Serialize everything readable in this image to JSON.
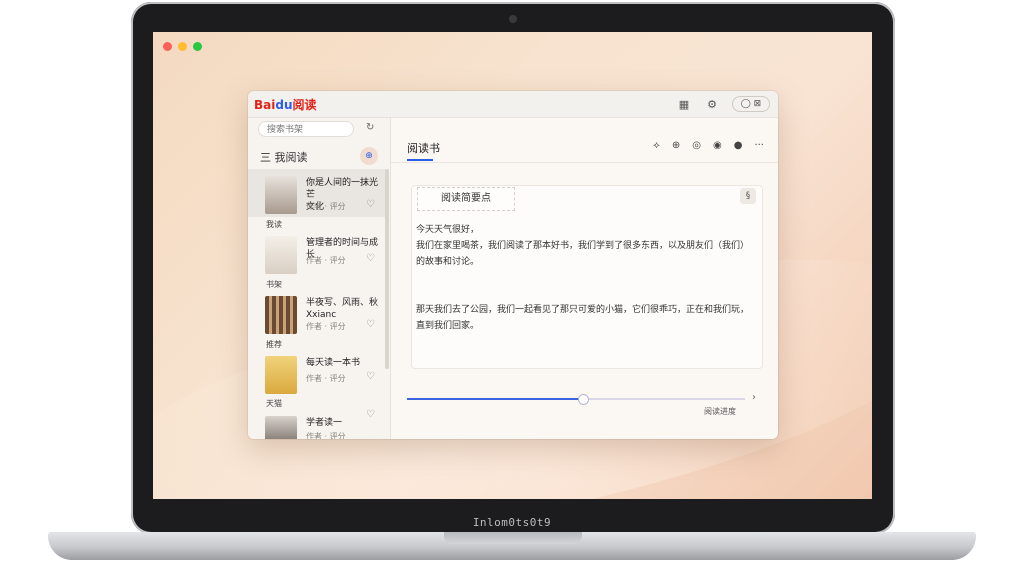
{
  "bezel_label": "Inlom0ts0t9",
  "colors": {
    "accent": "#2a5ee8",
    "brand_red": "#e2231a",
    "traffic_close": "#fe5f57",
    "traffic_min": "#febc2e",
    "traffic_max": "#28c840"
  },
  "app": {
    "brand_main": "Bai",
    "brand_accent": "du",
    "brand_suffix": "阅读",
    "titlebar_icons": [
      "grid-icon",
      "settings-icon"
    ],
    "titlebar_pill": "◯ ⊠"
  },
  "sidebar": {
    "search_placeholder": "搜索书架",
    "refresh_icon": "↻",
    "header": "三 我阅读",
    "add_icon": "⊕",
    "items": [
      {
        "title": "你是人间的一抹光芒",
        "subtitle": "文化",
        "meta": "作者 · 评分",
        "group_after": "我读"
      },
      {
        "title": "管理者的时间与成长",
        "subtitle": "",
        "meta": "作者 · 评分",
        "group_after": "书架"
      },
      {
        "title": "半夜写、风雨、秋",
        "subtitle": "Xxianc",
        "meta": "作者 · 评分",
        "group_after": "推荐"
      },
      {
        "title": "每天读一本书",
        "subtitle": "",
        "meta": "作者 · 评分",
        "group_after": "天猫"
      },
      {
        "title": "学者读一",
        "subtitle": "",
        "meta": "作者 · 评分",
        "group_after": ""
      }
    ]
  },
  "main": {
    "title": "阅读书",
    "tools": [
      "⟡",
      "⊕",
      "◎",
      "◉",
      "●",
      "···"
    ],
    "card": {
      "label": "阅读简要点",
      "tag": "§",
      "paragraph1_lead": "今天天气很好，",
      "paragraph1_body": "我们在家里喝茶，我们阅读了那本好书，我们学到了很多东西，以及朋友们（我们）的故事和讨论。",
      "paragraph2": "那天我们去了公园，我们一起看见了那只可爱的小猫，它们很乖巧，正在和我们玩，直到我们回家。"
    },
    "progress_percent": 52,
    "progress_label": "阅读进度"
  }
}
